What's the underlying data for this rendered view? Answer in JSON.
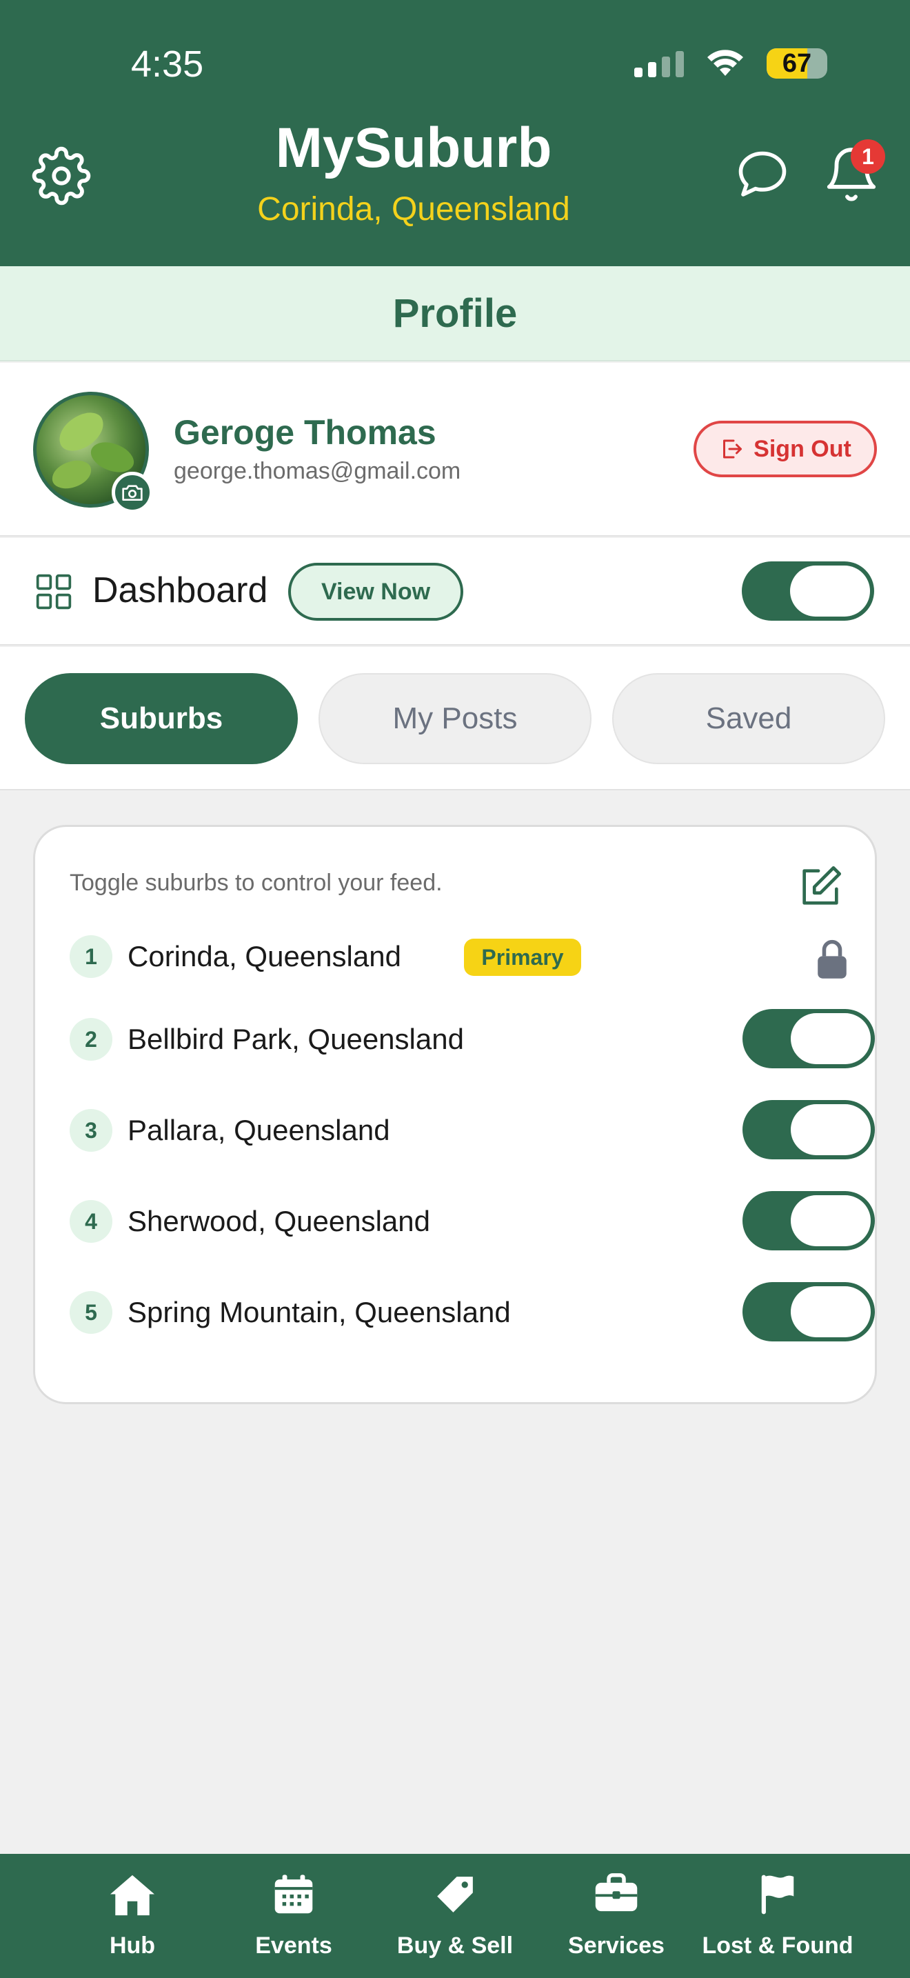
{
  "status_bar": {
    "time": "4:35",
    "battery": "67"
  },
  "header": {
    "app_name": "MySuburb",
    "location": "Corinda, Queensland",
    "notification_count": "1"
  },
  "page": {
    "title": "Profile"
  },
  "profile": {
    "name": "Geroge Thomas",
    "email": "george.thomas@gmail.com",
    "sign_out_label": "Sign Out"
  },
  "dashboard": {
    "label": "Dashboard",
    "view_now_label": "View Now",
    "toggle_on": true
  },
  "tabs": [
    {
      "label": "Suburbs",
      "active": true
    },
    {
      "label": "My Posts",
      "active": false
    },
    {
      "label": "Saved",
      "active": false
    }
  ],
  "suburbs": {
    "hint": "Toggle suburbs to control your feed.",
    "primary_badge": "Primary",
    "items": [
      {
        "num": "1",
        "name": "Corinda, Queensland",
        "primary": true,
        "enabled": true
      },
      {
        "num": "2",
        "name": "Bellbird Park, Queensland",
        "primary": false,
        "enabled": true
      },
      {
        "num": "3",
        "name": "Pallara, Queensland",
        "primary": false,
        "enabled": true
      },
      {
        "num": "4",
        "name": "Sherwood, Queensland",
        "primary": false,
        "enabled": true
      },
      {
        "num": "5",
        "name": "Spring Mountain, Queensland",
        "primary": false,
        "enabled": true
      }
    ]
  },
  "bottom_nav": [
    {
      "label": "Hub",
      "icon": "home-icon"
    },
    {
      "label": "Events",
      "icon": "calendar-icon"
    },
    {
      "label": "Buy & Sell",
      "icon": "tag-icon"
    },
    {
      "label": "Services",
      "icon": "briefcase-icon"
    },
    {
      "label": "Lost & Found",
      "icon": "flag-icon"
    }
  ],
  "colors": {
    "brand_green": "#2e6a4f",
    "accent_yellow": "#f4d21c",
    "light_green": "#e3f4e8",
    "danger_red": "#e04646"
  }
}
